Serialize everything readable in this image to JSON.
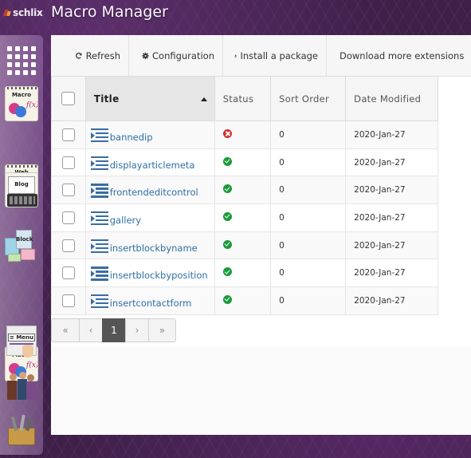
{
  "app": {
    "logo_text": "schlix",
    "title": "Macro Manager"
  },
  "dock": {
    "items": [
      {
        "name": "app-grid",
        "label": ""
      },
      {
        "name": "macro",
        "label": "Macro"
      },
      {
        "name": "web-pages",
        "label": "Web Pages"
      },
      {
        "name": "blog",
        "label": "Blog"
      },
      {
        "name": "block",
        "label": "Block"
      },
      {
        "name": "macro-2",
        "label": "Macro"
      },
      {
        "name": "menu",
        "label": "Menu"
      },
      {
        "name": "users",
        "label": ""
      },
      {
        "name": "toolbox",
        "label": ""
      }
    ]
  },
  "toolbar": {
    "refresh_label": "Refresh",
    "configuration_label": "Configuration",
    "install_label": "Install a package",
    "download_label": "Download more extensions"
  },
  "table": {
    "columns": {
      "title": "Title",
      "status": "Status",
      "sort_order": "Sort Order",
      "date_modified": "Date Modified"
    },
    "rows": [
      {
        "title": "bannedip",
        "status": "error",
        "sort_order": "0",
        "date": "2020-Jan-27"
      },
      {
        "title": "displayarticlemeta",
        "status": "ok",
        "sort_order": "0",
        "date": "2020-Jan-27"
      },
      {
        "title": "frontendeditcontrol",
        "status": "ok",
        "sort_order": "0",
        "date": "2020-Jan-27"
      },
      {
        "title": "gallery",
        "status": "ok",
        "sort_order": "0",
        "date": "2020-Jan-27"
      },
      {
        "title": "insertblockbyname",
        "status": "ok",
        "sort_order": "0",
        "date": "2020-Jan-27"
      },
      {
        "title": "insertblockbyposition",
        "status": "ok",
        "sort_order": "0",
        "date": "2020-Jan-27"
      },
      {
        "title": "insertcontactform",
        "status": "ok",
        "sort_order": "0",
        "date": "2020-Jan-27"
      }
    ]
  },
  "pager": {
    "first": "«",
    "prev": "‹",
    "current": "1",
    "next": "›",
    "last": "»"
  },
  "colors": {
    "accent_link": "#2f6fa5",
    "status_ok": "#1a9a3a",
    "status_error": "#d12f2f",
    "background": "#3d1f47"
  }
}
